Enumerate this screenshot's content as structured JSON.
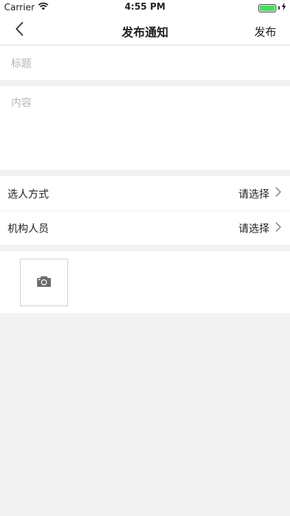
{
  "status_bar": {
    "carrier": "Carrier",
    "time": "4:55 PM"
  },
  "nav": {
    "title": "发布通知",
    "action": "发布"
  },
  "form": {
    "title_placeholder": "标题",
    "content_placeholder": "内容"
  },
  "rows": [
    {
      "label": "选人方式",
      "value": "请选择"
    },
    {
      "label": "机构人员",
      "value": "请选择"
    }
  ],
  "icons": {
    "back": "chevron-left-icon",
    "chevron": "chevron-right-icon",
    "camera": "camera-icon",
    "wifi": "wifi-icon",
    "battery": "battery-icon",
    "charging": "charging-bolt-icon"
  },
  "colors": {
    "battery_fill": "#4cd964",
    "placeholder": "#b6b6b6",
    "background": "#f2f2f2"
  }
}
